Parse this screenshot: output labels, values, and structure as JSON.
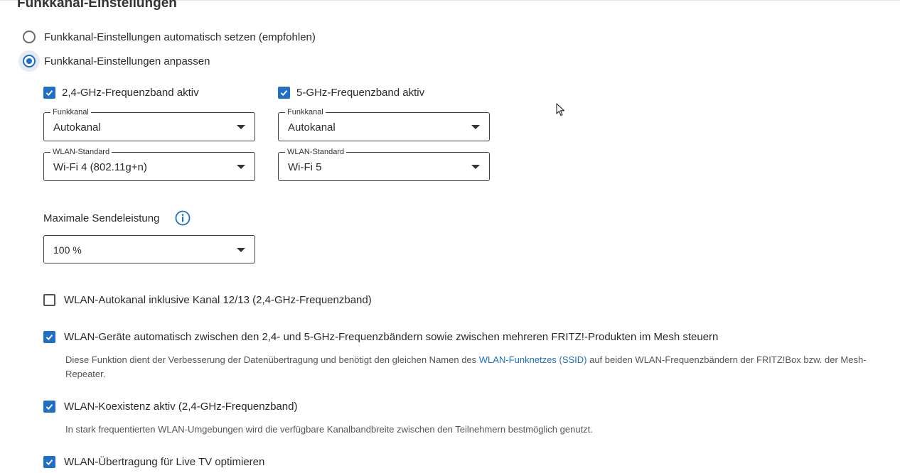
{
  "section": {
    "title": "Funkkanal-Einstellungen"
  },
  "radio_options": [
    {
      "label": "Funkkanal-Einstellungen automatisch setzen (empfohlen)",
      "selected": false
    },
    {
      "label": "Funkkanal-Einstellungen anpassen",
      "selected": true
    }
  ],
  "band24": {
    "checkbox_label": "2,4-GHz-Frequenzband aktiv",
    "checked": true,
    "channel_legend": "Funkkanal",
    "channel_value": "Autokanal",
    "standard_legend": "WLAN-Standard",
    "standard_value": "Wi-Fi 4 (802.11g+n)"
  },
  "band5": {
    "checkbox_label": "5-GHz-Frequenzband aktiv",
    "checked": true,
    "channel_legend": "Funkkanal",
    "channel_value": "Autokanal",
    "standard_legend": "WLAN-Standard",
    "standard_value": "Wi-Fi 5"
  },
  "power": {
    "label": "Maximale Sendeleistung",
    "value": "100 %",
    "info_icon": "info-circle-icon"
  },
  "options": {
    "autochannel": {
      "label": "WLAN-Autokanal inklusive Kanal 12/13 (2,4-GHz-Frequenzband)",
      "checked": false
    },
    "band_steering": {
      "label": "WLAN-Geräte automatisch zwischen den 2,4- und 5-GHz-Frequenzbändern sowie zwischen mehreren FRITZ!-Produkten im Mesh steuern",
      "checked": true,
      "desc_before": "Diese Funktion dient der Verbesserung der Datenübertragung und benötigt den gleichen Namen des ",
      "desc_link": "WLAN-Funknetzes (SSID)",
      "desc_after": " auf beiden WLAN-Frequenzbändern der FRITZ!Box bzw. der Mesh-Repeater."
    },
    "coexistence": {
      "label": "WLAN-Koexistenz aktiv (2,4-GHz-Frequenzband)",
      "checked": true,
      "desc": "In stark frequentierten WLAN-Umgebungen wird die verfügbare Kanalbandbreite zwischen den Teilnehmern bestmöglich genutzt."
    },
    "live_tv": {
      "label": "WLAN-Übertragung für Live TV optimieren",
      "checked": true
    }
  },
  "colors": {
    "accent": "#1f6fc7",
    "text": "#2b2b2b",
    "muted": "#555555"
  }
}
